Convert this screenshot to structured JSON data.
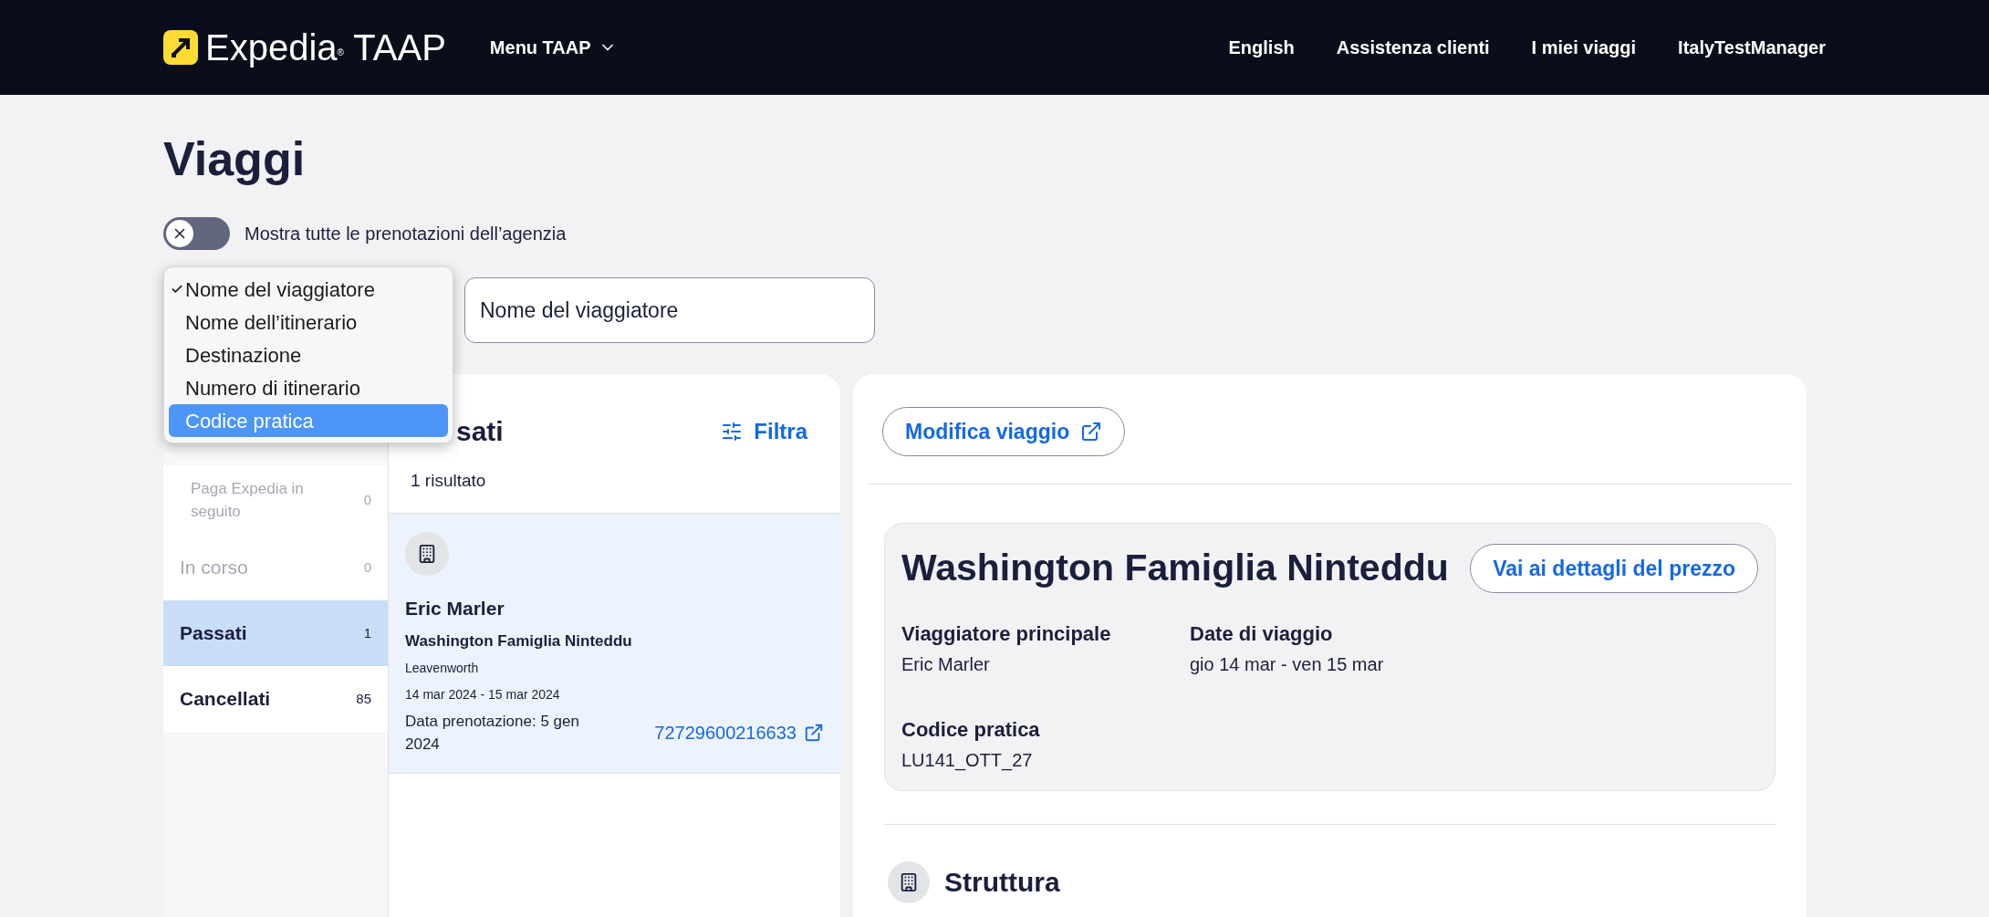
{
  "header": {
    "brand": "Expedia",
    "brand_mark": "®",
    "product": "TAAP",
    "menu": "Menu TAAP",
    "nav": [
      "English",
      "Assistenza clienti",
      "I miei viaggi",
      "ItalyTestManager"
    ]
  },
  "page_title": "Viaggi",
  "agency_toggle": {
    "label": "Mostra tutte le prenotazioni dell’agenzia",
    "on": false
  },
  "search_type_menu": [
    {
      "label": "Nome del viaggiatore",
      "checked": true,
      "selected": false
    },
    {
      "label": "Nome dell’itinerario",
      "checked": false,
      "selected": false
    },
    {
      "label": "Destinazione",
      "checked": false,
      "selected": false
    },
    {
      "label": "Numero di itinerario",
      "checked": false,
      "selected": false
    },
    {
      "label": "Codice pratica",
      "checked": false,
      "selected": true
    }
  ],
  "search_field": {
    "placeholder": "Nome del viaggiatore"
  },
  "sidebar": {
    "items": [
      {
        "label": "Paga Expedia in seguito",
        "count": "0",
        "disabled": true,
        "selected": false,
        "sub": true
      },
      {
        "label": "In corso",
        "count": "0",
        "disabled": true,
        "selected": false,
        "sub": false
      },
      {
        "label": "Passati",
        "count": "1",
        "disabled": false,
        "selected": true,
        "sub": false
      },
      {
        "label": "Cancellati",
        "count": "85",
        "disabled": false,
        "selected": false,
        "sub": false
      }
    ]
  },
  "results": {
    "heading": "sati",
    "filter": "Filtra",
    "count": "1 risultato",
    "trips": [
      {
        "traveler": "Eric Marler",
        "itinerary": "Washington Famiglia Ninteddu",
        "destination": "Leavenworth",
        "dates": "14 mar 2024 - 15 mar 2024",
        "booked": "Data prenotazione: 5 gen 2024",
        "number": "72729600216633",
        "selected": true
      }
    ]
  },
  "detail": {
    "edit_button": "Modifica viaggio",
    "title": "Washington Famiglia Ninteddu",
    "price_button": "Vai ai dettagli del prezzo",
    "fields": [
      {
        "label": "Viaggiatore principale",
        "value": "Eric Marler"
      },
      {
        "label": "Date di viaggio",
        "value": "gio 14 mar - ven 15 mar"
      },
      {
        "label": "Codice pratica",
        "value": "LU141_OTT_27"
      }
    ],
    "section": "Struttura"
  }
}
